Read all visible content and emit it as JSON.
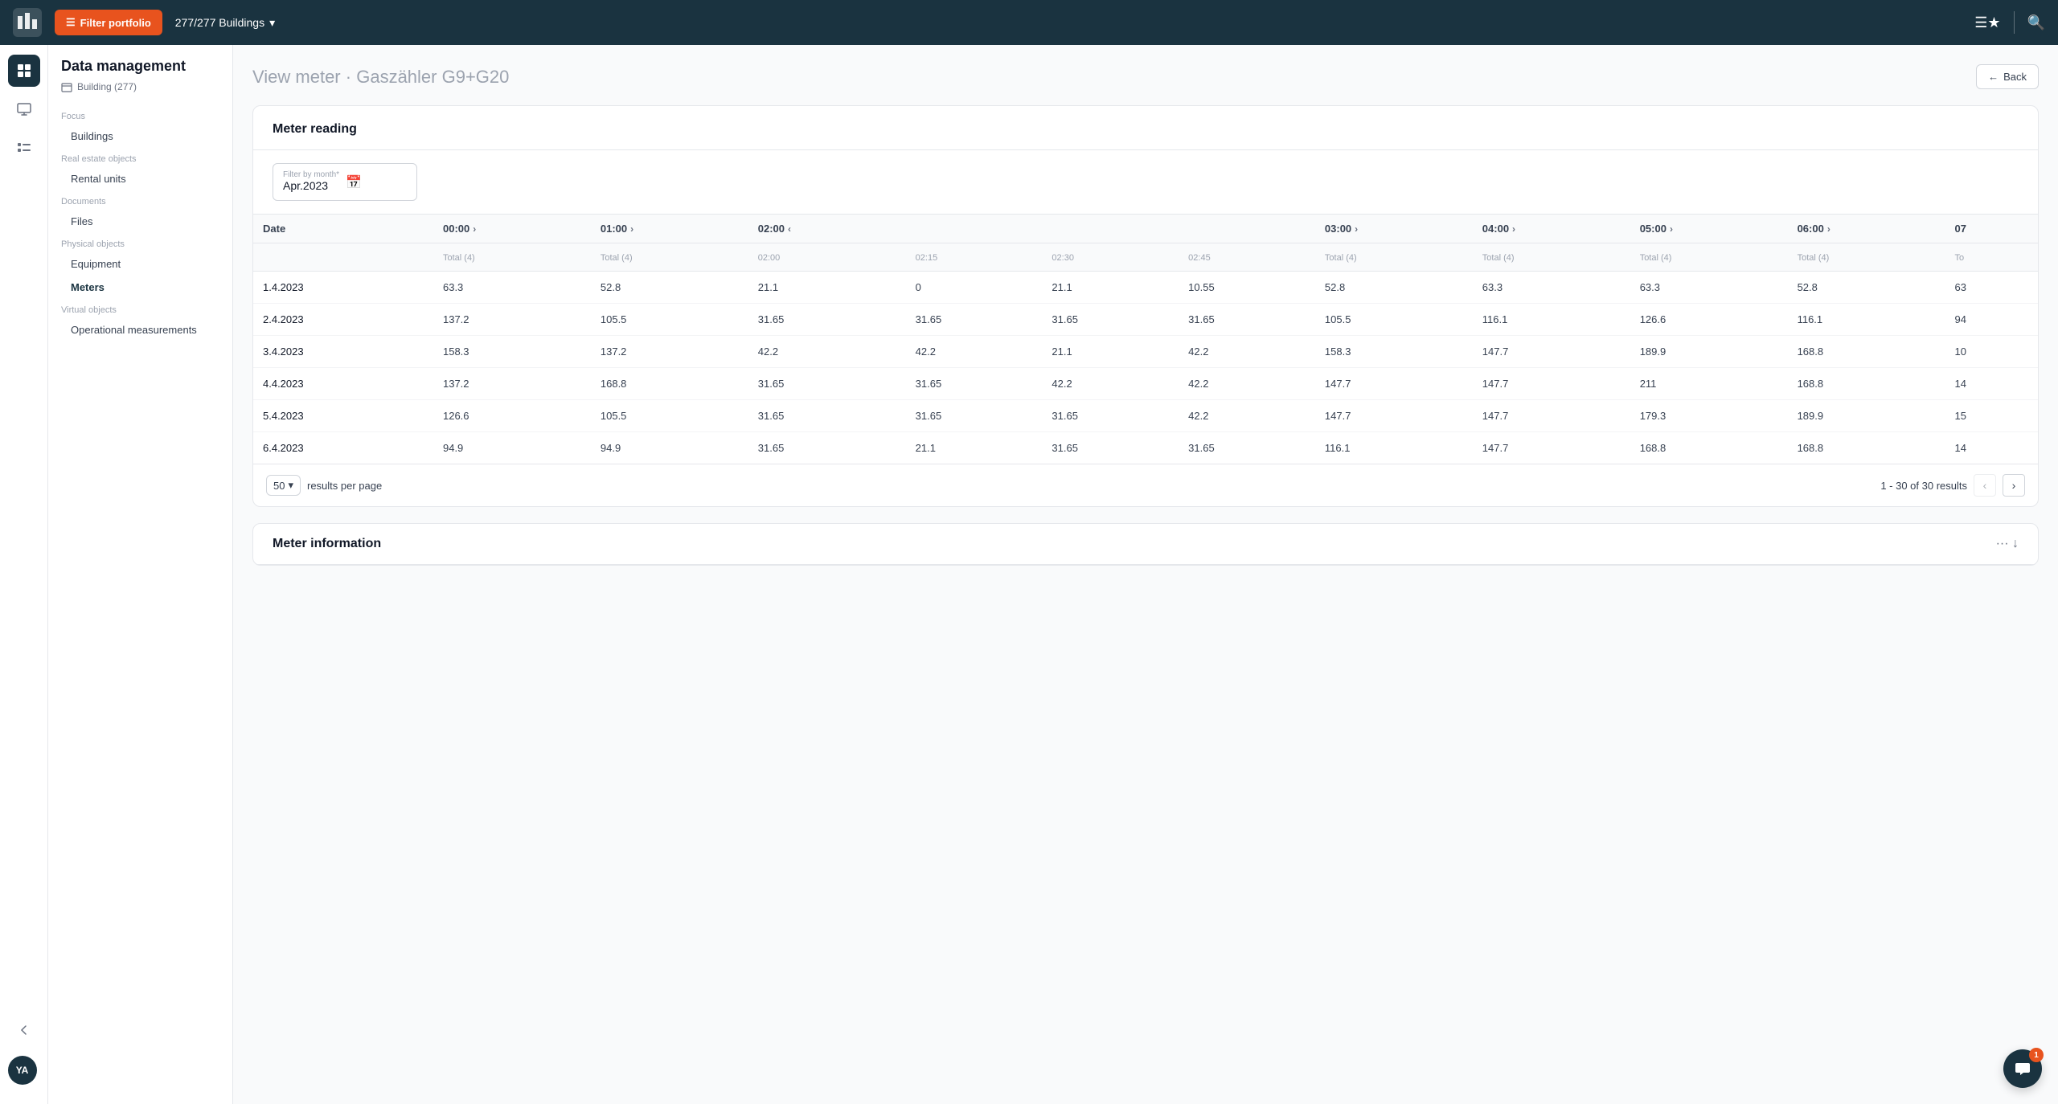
{
  "topNav": {
    "filterBtn": "Filter portfolio",
    "buildingsCount": "277/277 Buildings"
  },
  "sidebar": {
    "title": "Data management",
    "subtitle": "Building (277)",
    "sections": [
      {
        "label": "Focus",
        "items": [
          "Buildings"
        ]
      },
      {
        "label": "Real estate objects",
        "items": [
          "Rental units"
        ]
      },
      {
        "label": "Documents",
        "items": [
          "Files"
        ]
      },
      {
        "label": "Physical objects",
        "items": [
          "Equipment",
          "Meters"
        ]
      },
      {
        "label": "Virtual objects",
        "items": [
          "Operational measurements"
        ]
      }
    ]
  },
  "page": {
    "title": "View meter",
    "subtitle": "Gaszähler G9+G20",
    "backBtn": "Back"
  },
  "meterReading": {
    "cardTitle": "Meter reading",
    "filterLabel": "Filter by month*",
    "filterValue": "Apr.2023",
    "columns": [
      {
        "main": "Date",
        "sub": ""
      },
      {
        "main": "00:00",
        "sub": "Total (4)"
      },
      {
        "main": "01:00",
        "sub": "Total (4)"
      },
      {
        "main": "02:00",
        "sub": "02:00"
      },
      {
        "main": "",
        "sub": "02:15"
      },
      {
        "main": "",
        "sub": "02:30"
      },
      {
        "main": "",
        "sub": "02:45"
      },
      {
        "main": "03:00",
        "sub": "Total (4)"
      },
      {
        "main": "04:00",
        "sub": "Total (4)"
      },
      {
        "main": "05:00",
        "sub": "Total (4)"
      },
      {
        "main": "06:00",
        "sub": "Total (4)"
      },
      {
        "main": "07",
        "sub": "To"
      }
    ],
    "rows": [
      [
        "1.4.2023",
        "63.3",
        "52.8",
        "21.1",
        "0",
        "21.1",
        "10.55",
        "52.8",
        "63.3",
        "63.3",
        "52.8",
        "63"
      ],
      [
        "2.4.2023",
        "137.2",
        "105.5",
        "31.65",
        "31.65",
        "31.65",
        "31.65",
        "105.5",
        "116.1",
        "126.6",
        "116.1",
        "94"
      ],
      [
        "3.4.2023",
        "158.3",
        "137.2",
        "42.2",
        "42.2",
        "21.1",
        "42.2",
        "158.3",
        "147.7",
        "189.9",
        "168.8",
        "10"
      ],
      [
        "4.4.2023",
        "137.2",
        "168.8",
        "31.65",
        "31.65",
        "42.2",
        "42.2",
        "147.7",
        "147.7",
        "211",
        "168.8",
        "14"
      ],
      [
        "5.4.2023",
        "126.6",
        "105.5",
        "31.65",
        "31.65",
        "31.65",
        "42.2",
        "147.7",
        "147.7",
        "179.3",
        "189.9",
        "15"
      ],
      [
        "6.4.2023",
        "94.9",
        "94.9",
        "31.65",
        "21.1",
        "31.65",
        "31.65",
        "116.1",
        "147.7",
        "168.8",
        "168.8",
        "14"
      ]
    ],
    "perPage": "50",
    "paginationInfo": "1 - 30 of 30 results"
  },
  "meterInfo": {
    "cardTitle": "Meter information"
  },
  "icons": {
    "filter": "☰",
    "chevronDown": "▾",
    "chevronRight": "›",
    "chevronLeft": "‹",
    "arrowLeft": "←",
    "calendar": "📅",
    "search": "🔍",
    "star": "★",
    "building": "🏢",
    "dots": "···",
    "chat": "💬"
  }
}
